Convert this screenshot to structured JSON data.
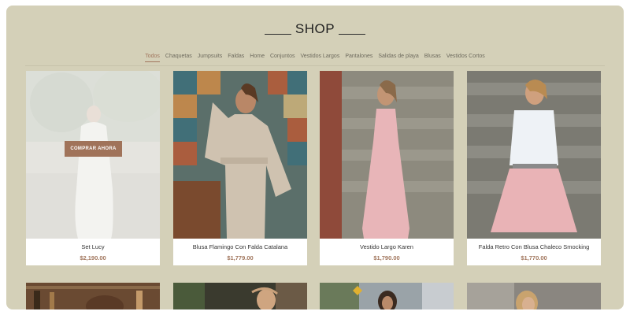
{
  "header": {
    "title": "SHOP"
  },
  "tabs": [
    "Todos",
    "Chaquetas",
    "Jumpsuits",
    "Faldas",
    "Home",
    "Conjuntos",
    "Vestidos Largos",
    "Pantalones",
    "Salidas de playa",
    "Blusas",
    "Vestidos Cortos"
  ],
  "active_tab": "Todos",
  "products": [
    {
      "name": "Set Lucy",
      "price": "$2,190.00",
      "hover_button": "COMPRAR AHORA"
    },
    {
      "name": "Blusa Flamingo Con Falda Catalana",
      "price": "$1,779.00"
    },
    {
      "name": "Vestido Largo Karen",
      "price": "$1,790.00"
    },
    {
      "name": "Falda Retro Con Blusa Chaleco Smocking",
      "price": "$1,770.00"
    }
  ],
  "colors": {
    "background": "#d4d0b8",
    "accent": "#a1765d",
    "button": "#a0735a"
  }
}
